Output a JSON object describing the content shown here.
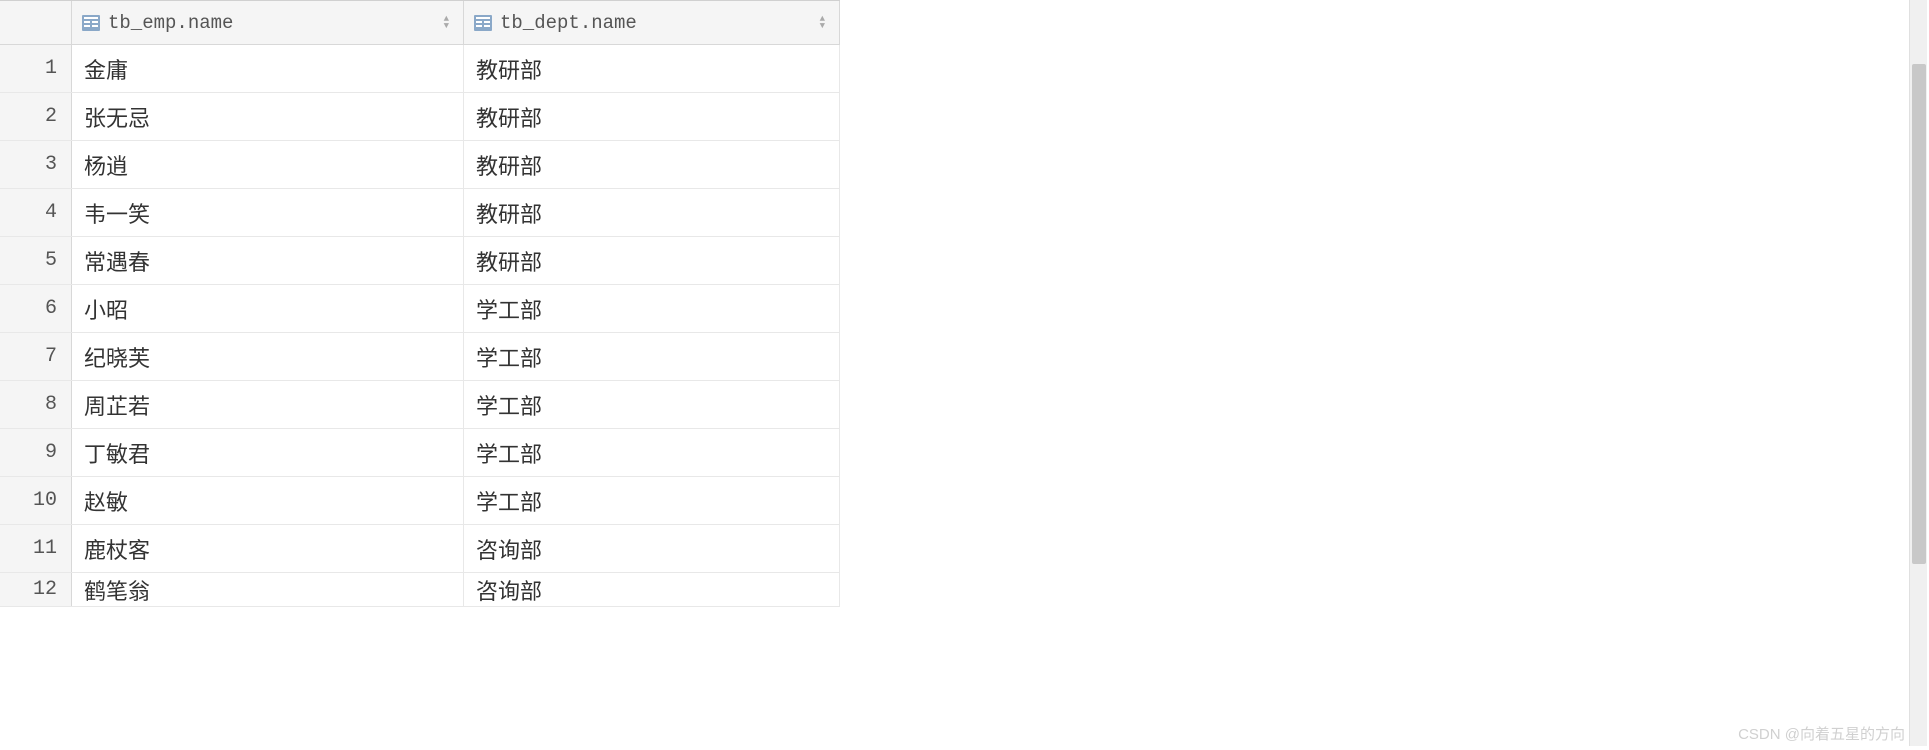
{
  "table": {
    "columns": [
      {
        "label": "tb_emp.name"
      },
      {
        "label": "tb_dept.name"
      }
    ],
    "rows": [
      {
        "num": "1",
        "emp_name": "金庸",
        "dept_name": "教研部"
      },
      {
        "num": "2",
        "emp_name": "张无忌",
        "dept_name": "教研部"
      },
      {
        "num": "3",
        "emp_name": "杨逍",
        "dept_name": "教研部"
      },
      {
        "num": "4",
        "emp_name": "韦一笑",
        "dept_name": "教研部"
      },
      {
        "num": "5",
        "emp_name": "常遇春",
        "dept_name": "教研部"
      },
      {
        "num": "6",
        "emp_name": "小昭",
        "dept_name": "学工部"
      },
      {
        "num": "7",
        "emp_name": "纪晓芙",
        "dept_name": "学工部"
      },
      {
        "num": "8",
        "emp_name": "周芷若",
        "dept_name": "学工部"
      },
      {
        "num": "9",
        "emp_name": "丁敏君",
        "dept_name": "学工部"
      },
      {
        "num": "10",
        "emp_name": "赵敏",
        "dept_name": "学工部"
      },
      {
        "num": "11",
        "emp_name": "鹿杖客",
        "dept_name": "咨询部"
      },
      {
        "num": "12",
        "emp_name": "鹤笔翁",
        "dept_name": "咨询部"
      }
    ]
  },
  "watermark": "CSDN @向着五星的方向"
}
